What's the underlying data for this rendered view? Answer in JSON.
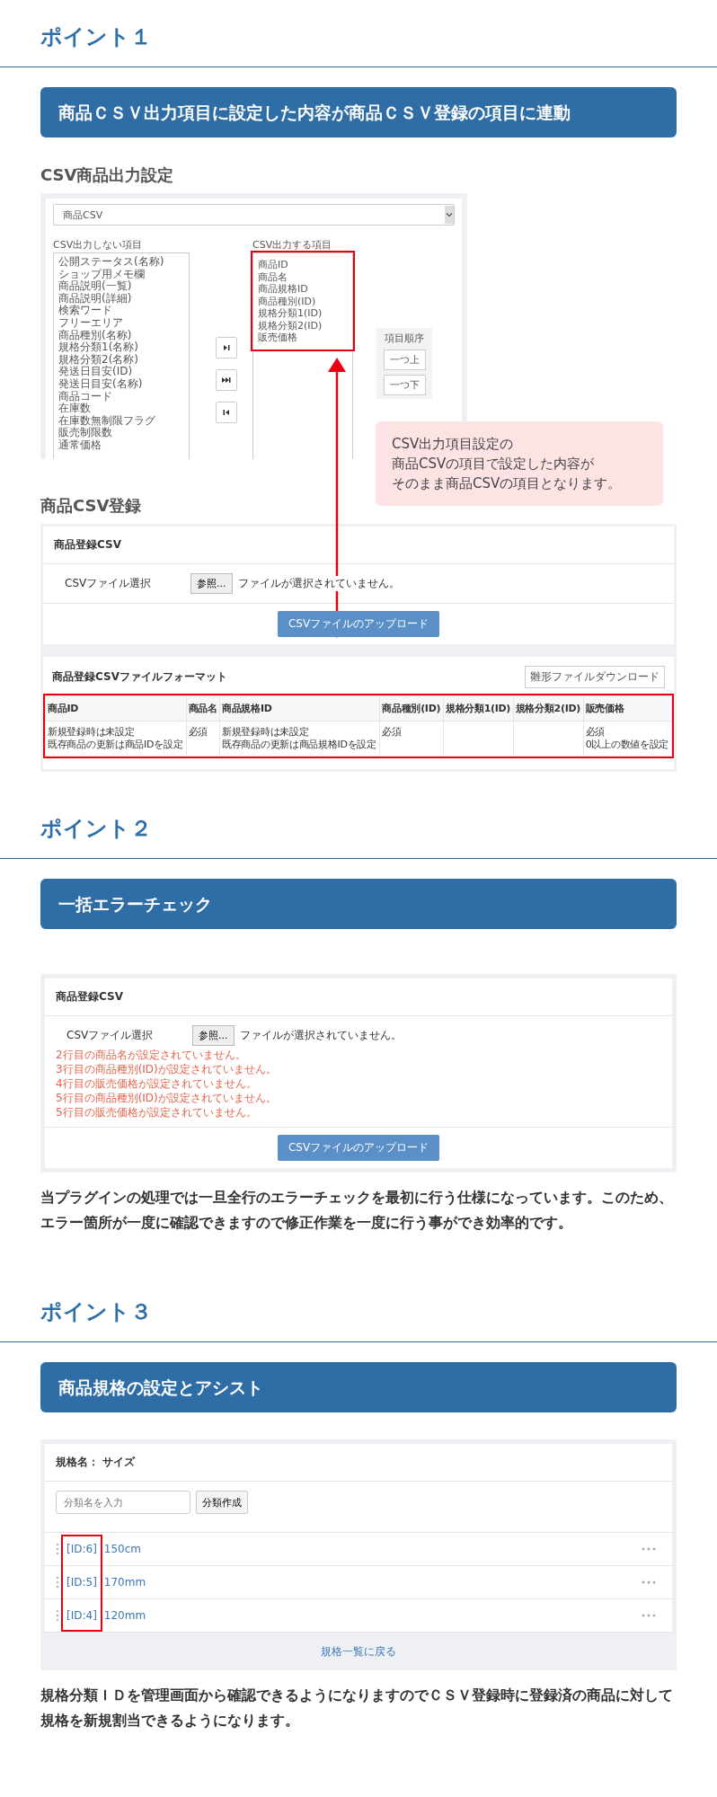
{
  "point1": {
    "heading": "ポイント１",
    "banner": "商品ＣＳＶ出力項目に設定した内容が商品ＣＳＶ登録の項目に連動",
    "export_settings": {
      "title": "CSV商品出力設定",
      "select_value": "商品CSV",
      "excluded_label": "CSV出力しない項目",
      "excluded_items": [
        "公開ステータス(名称)",
        "ショップ用メモ欄",
        "商品説明(一覧)",
        "商品説明(詳細)",
        "検索ワード",
        "フリーエリア",
        "商品種別(名称)",
        "規格分類1(名称)",
        "規格分類2(名称)",
        "発送日目安(ID)",
        "発送日目安(名称)",
        "商品コード",
        "在庫数",
        "在庫数無制限フラグ",
        "販売制限数",
        "通常価格"
      ],
      "included_label": "CSV出力する項目",
      "included_items": [
        "商品ID",
        "商品名",
        "商品規格ID",
        "商品種別(ID)",
        "規格分類1(ID)",
        "規格分類2(ID)",
        "販売価格"
      ],
      "order_label": "項目順序",
      "order_buttons": [
        "一つ上",
        "一つ下"
      ]
    },
    "callout": [
      "CSV出力項目設定の",
      "商品CSVの項目で設定した内容が",
      "そのまま商品CSVの項目となります。"
    ],
    "register": {
      "title": "商品CSV登録",
      "panel_title": "商品登録CSV",
      "file_label": "CSVファイル選択",
      "browse": "参照...",
      "no_file": "ファイルが選択されていません。",
      "upload": "CSVファイルのアップロード",
      "format_title": "商品登録CSVファイルフォーマット",
      "template_download": "雛形ファイルダウンロード",
      "columns": [
        "商品ID",
        "商品名",
        "商品規格ID",
        "商品種別(ID)",
        "規格分類1(ID)",
        "規格分類2(ID)",
        "販売価格"
      ],
      "row": {
        "column_1": [
          "新規登録時は未設定",
          "既存商品の更新は商品IDを設定"
        ],
        "column_2": [
          "必須"
        ],
        "column_3": [
          "新規登録時は未設定",
          "既存商品の更新は商品規格IDを設定"
        ],
        "column_4": [
          "必須"
        ],
        "column_7": [
          "必須",
          "0以上の数値を設定"
        ]
      }
    }
  },
  "point2": {
    "heading": "ポイント２",
    "banner": "一括エラーチェック",
    "upload": {
      "panel_title": "商品登録CSV",
      "file_label": "CSVファイル選択",
      "browse": "参照...",
      "no_file": "ファイルが選択されていません。",
      "errors": [
        "2行目の商品名が設定されていません。",
        "3行目の商品種別(ID)が設定されていません。",
        "4行目の販売価格が設定されていません。",
        "5行目の商品種別(ID)が設定されていません。",
        "5行目の販売価格が設定されていません。"
      ],
      "upload": "CSVファイルのアップロード"
    },
    "description": "当プラグインの処理では一旦全行のエラーチェックを最初に行う仕様になっています。このため、エラー箇所が一度に確認できますので修正作業を一度に行う事ができ効率的です。"
  },
  "point3": {
    "heading": "ポイント３",
    "banner": "商品規格の設定とアシスト",
    "spec": {
      "title": "規格名： サイズ",
      "placeholder": "分類名を入力",
      "create": "分類作成",
      "items": [
        {
          "id": "[ID:6]",
          "name": "150cm"
        },
        {
          "id": "[ID:5]",
          "name": "170mm"
        },
        {
          "id": "[ID:4]",
          "name": "120mm"
        }
      ],
      "back": "規格一覧に戻る"
    },
    "description": "規格分類ＩＤを管理画面から確認できるようになりますのでＣＳＶ登録時に登録済の商品に対して規格を新規割当できるようになります。"
  }
}
